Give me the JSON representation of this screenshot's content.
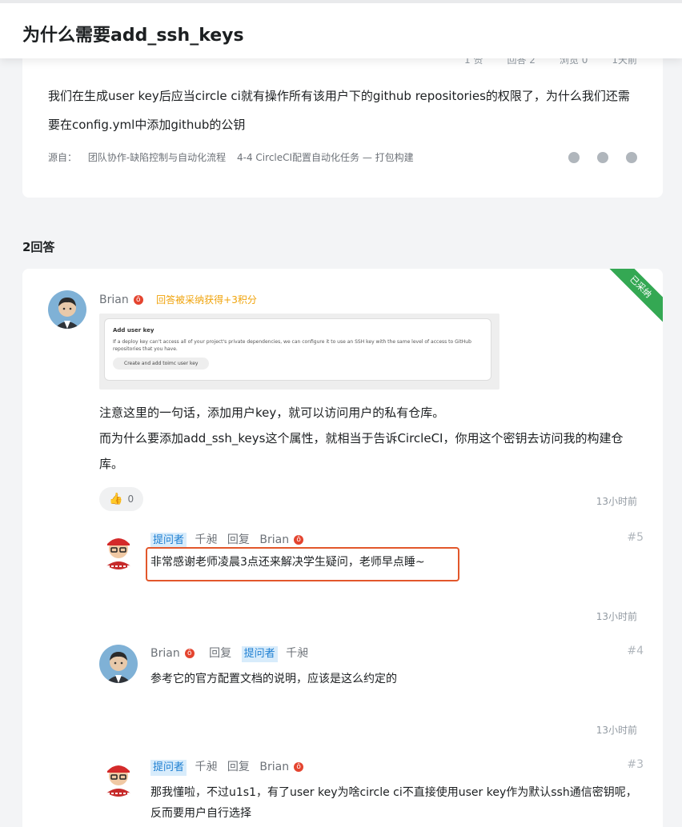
{
  "header": {
    "title": "为什么需要add_ssh_keys"
  },
  "question": {
    "meta": [
      "1 赞",
      "回答 2",
      "浏览 0",
      "1天前"
    ],
    "text": "我们在生成user key后应当circle ci就有操作所有该用户下的github repositories的权限了，为什么我们还需要在config.yml中添加github的公钥",
    "source_label": "源自：",
    "source_course": "团队协作-缺陷控制与自动化流程",
    "source_chapter": "4-4 CircleCI配置自动化任务 — 打包构建",
    "share_icons": [
      "wechat-icon",
      "weibo-icon",
      "qq-icon"
    ]
  },
  "answers_count": "2回答",
  "answer": {
    "ribbon": "已采纳",
    "author": "Brian",
    "hot_badge": "ô",
    "award": "回答被采纳获得+3积分",
    "screenshot": {
      "title": "Add user key",
      "body": "If a deploy key can't access all of your project's private dependencies, we can configure it to use an SSH key with the same level of access to GitHub repositories that you have.",
      "button": "Create and add toimc user key"
    },
    "text_line1": "注意这里的一句话，添加用户key，就可以访问用户的私有仓库。",
    "text_line2": "而为什么要添加add_ssh_keys这个属性，就相当于告诉CircleCI，你用这个密钥去访问我的构建仓库。",
    "likes": "0",
    "time": "13小时前"
  },
  "replies": [
    {
      "tag": "提问者",
      "author": "千昶",
      "action": "回复",
      "target": "Brian",
      "num": "#5",
      "text": "非常感谢老师凌晨3点还来解决学生疑问，老师早点睡~",
      "time": "13小时前"
    },
    {
      "author": "Brian",
      "action": "回复",
      "tag": "提问者",
      "target": "千昶",
      "num": "#4",
      "text": "参考它的官方配置文档的说明，应该是这么约定的",
      "time": "13小时前"
    },
    {
      "tag": "提问者",
      "author": "千昶",
      "action": "回复",
      "target": "Brian",
      "num": "#3",
      "text": "那我懂啦，不过u1s1，有了user key为啥circle ci不直接使用user key作为默认ssh通信密钥呢，反而要用户自行选择"
    }
  ]
}
